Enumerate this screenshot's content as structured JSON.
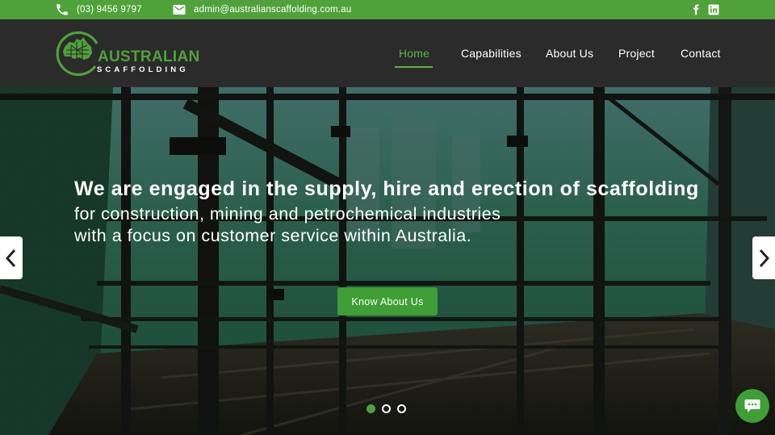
{
  "topbar": {
    "phone": "(03) 9456 9797",
    "email": "admin@australianscaffolding.com.au",
    "phone_icon": "phone-icon",
    "email_icon": "mail-icon",
    "social": [
      "facebook-icon",
      "linkedin-icon"
    ]
  },
  "brand": {
    "line1": "AUSTRALIAN",
    "line2": "SCAFFOLDING"
  },
  "nav": {
    "items": [
      {
        "label": "Home",
        "active": true
      },
      {
        "label": "Capabilities",
        "active": false
      },
      {
        "label": "About Us",
        "active": false
      },
      {
        "label": "Project",
        "active": false
      },
      {
        "label": "Contact",
        "active": false
      }
    ]
  },
  "hero": {
    "headline": "We are engaged in the supply, hire and erection of scaffolding",
    "sub1": "for construction, mining and petrochemical industries",
    "sub2": "with a focus on customer service within Australia.",
    "cta": "Know About Us",
    "slides_total": 3,
    "active_slide": 1
  },
  "colors": {
    "accent": "#4fa23a",
    "header_bg": "#2b2b2b"
  }
}
